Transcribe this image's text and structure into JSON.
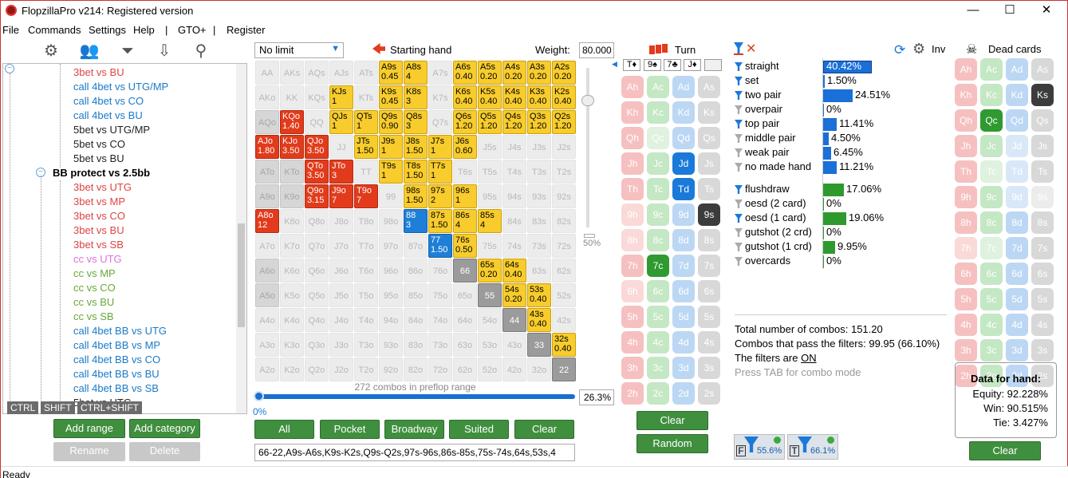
{
  "window": {
    "title": "FlopzillaPro v214: Registered version",
    "min": "—",
    "max": "☐",
    "close": "✕"
  },
  "menu": [
    "File",
    "Commands",
    "Settings",
    "Help",
    "|",
    "GTO+",
    "|",
    "Register"
  ],
  "tree": {
    "items": [
      {
        "t": "3bet vs BU",
        "c": "#d44"
      },
      {
        "t": "call 4bet vs UTG/MP",
        "c": "#1a7ac8"
      },
      {
        "t": "call 4bet vs CO",
        "c": "#1a7ac8"
      },
      {
        "t": "call 4bet vs BU",
        "c": "#1a7ac8"
      },
      {
        "t": "5bet vs UTG/MP",
        "c": "#222"
      },
      {
        "t": "5bet vs CO",
        "c": "#222"
      },
      {
        "t": "5bet vs BU",
        "c": "#222"
      },
      {
        "t": "BB protect vs 2.5bb",
        "c": "#000",
        "group": true
      },
      {
        "t": "3bet vs UTG",
        "c": "#d44"
      },
      {
        "t": "3bet vs MP",
        "c": "#d44"
      },
      {
        "t": "3bet vs CO",
        "c": "#d44"
      },
      {
        "t": "3bet vs BU",
        "c": "#d44"
      },
      {
        "t": "3bet vs SB",
        "c": "#d44"
      },
      {
        "t": "cc vs UTG",
        "c": "#e070d8"
      },
      {
        "t": "cc vs MP",
        "c": "#6aa83a"
      },
      {
        "t": "cc vs CO",
        "c": "#6aa83a"
      },
      {
        "t": "cc vs BU",
        "c": "#6aa83a"
      },
      {
        "t": "cc vs SB",
        "c": "#6aa83a"
      },
      {
        "t": "call 4bet BB vs UTG",
        "c": "#1a7ac8"
      },
      {
        "t": "call 4bet BB vs MP",
        "c": "#1a7ac8"
      },
      {
        "t": "call 4bet BB vs CO",
        "c": "#1a7ac8"
      },
      {
        "t": "call 4bet BB vs BU",
        "c": "#1a7ac8"
      },
      {
        "t": "call 4bet BB vs SB",
        "c": "#1a7ac8"
      }
    ],
    "partial": "5bet vs UTG"
  },
  "kbd": [
    "CTRL",
    "SHIFT",
    "CTRL+SHIFT"
  ],
  "buttons": {
    "add_range": "Add range",
    "add_category": "Add category",
    "rename": "Rename",
    "delete": "Delete"
  },
  "range": {
    "game": "No limit",
    "starting_hand": "Starting hand",
    "weight_label": "Weight:",
    "weight": "80.000",
    "combos": "272 combos in preflop range",
    "slider_pct": "0%",
    "pct": "26.3%",
    "side_pct": "50%",
    "buttons": [
      "All",
      "Pocket",
      "Broadway",
      "Suited",
      "Clear"
    ],
    "text": "66-22,A9s-A6s,K9s-K2s,Q9s-Q2s,97s-96s,86s-85s,75s-74s,64s,53s,4"
  },
  "ranks": [
    "A",
    "K",
    "Q",
    "J",
    "T",
    "9",
    "8",
    "7",
    "6",
    "5",
    "4",
    "3",
    "2"
  ],
  "weights": {
    "A9s": "0.45",
    "A8s": "4",
    "A6s": "0.40",
    "A5s": "0.20",
    "A4s": "0.20",
    "A3s": "0.20",
    "A2s": "0.20",
    "KJs": "1",
    "K9s": "0.45",
    "K8s": "3",
    "K6s": "0.40",
    "K5s": "0.40",
    "K4s": "0.40",
    "K3s": "0.40",
    "K2s": "0.40",
    "KQo": "1.40",
    "QJs": "1",
    "QTs": "1",
    "Q9s": "0.90",
    "Q8s": "3",
    "Q6s": "1.20",
    "Q5s": "1.20",
    "Q4s": "1.20",
    "Q3s": "1.20",
    "Q2s": "1.20",
    "AJo": "1.80",
    "KJo": "3.50",
    "QJo": "3.50",
    "JTs": "1.50",
    "J9s": "1",
    "J8s": "1.50",
    "J7s": "1",
    "J6s": "0.60",
    "QTo": "3.50",
    "JTo": "3",
    "T9s": "1",
    "T8s": "1.50",
    "T7s": "1",
    "Q9o": "3.15",
    "J9o": "7",
    "T9o": "7",
    "98s": "1.50",
    "97s": "2",
    "96s": "1",
    "A8o": "12",
    "88": "3",
    "87s": "1.50",
    "86s": "4",
    "85s": "4",
    "77": "1.50",
    "76s": "0.50",
    "65s": "0.20",
    "64s": "0.40",
    "54s": "0.20",
    "53s": "0.40",
    "43s": "0.40",
    "32s": "0.40"
  },
  "turn": {
    "label": "Turn",
    "board": [
      "T♦",
      "9♠",
      "7♣",
      "J♦"
    ]
  },
  "stats": {
    "made": [
      {
        "l": "straight",
        "p": "40.42%",
        "f": 0.4042,
        "on": true,
        "sel": true
      },
      {
        "l": "set",
        "p": "1.50%",
        "f": 0.015,
        "on": true
      },
      {
        "l": "two pair",
        "p": "24.51%",
        "f": 0.2451,
        "on": true
      },
      {
        "l": "overpair",
        "p": "0%",
        "f": 0,
        "on": false
      },
      {
        "l": "top pair",
        "p": "11.41%",
        "f": 0.1141,
        "on": true
      },
      {
        "l": "middle pair",
        "p": "4.50%",
        "f": 0.045,
        "on": false
      },
      {
        "l": "weak pair",
        "p": "6.45%",
        "f": 0.0645,
        "on": false
      },
      {
        "l": "no made hand",
        "p": "11.21%",
        "f": 0.1121,
        "on": false
      }
    ],
    "draws": [
      {
        "l": "flushdraw",
        "p": "17.06%",
        "f": 0.1706,
        "on": true
      },
      {
        "l": "oesd (2 card)",
        "p": "0%",
        "f": 0,
        "on": false
      },
      {
        "l": "oesd (1 card)",
        "p": "19.06%",
        "f": 0.1906,
        "on": true
      },
      {
        "l": "gutshot (2 crd)",
        "p": "0%",
        "f": 0,
        "on": false
      },
      {
        "l": "gutshot (1 crd)",
        "p": "9.95%",
        "f": 0.0995,
        "on": false
      },
      {
        "l": "overcards",
        "p": "0%",
        "f": 0,
        "on": false
      }
    ],
    "total": "Total number of combos: 151.20",
    "pass": "Combos that pass the filters: 99.95 (66.10%)",
    "filters_pre": "The filters are ",
    "filters_state": "ON",
    "tab": "Press TAB for combo mode",
    "inv": "Inv",
    "f1": "55.6%",
    "f2": "66.1%"
  },
  "dead": {
    "label": "Dead cards",
    "clear": "Clear"
  },
  "hand": {
    "title": "Data for hand:",
    "equity": "Equity: 92.228%",
    "win": "Win: 90.515%",
    "tie": "Tie: 3.427%"
  },
  "turn_buttons": {
    "clear": "Clear",
    "random": "Random"
  },
  "status": "Ready"
}
